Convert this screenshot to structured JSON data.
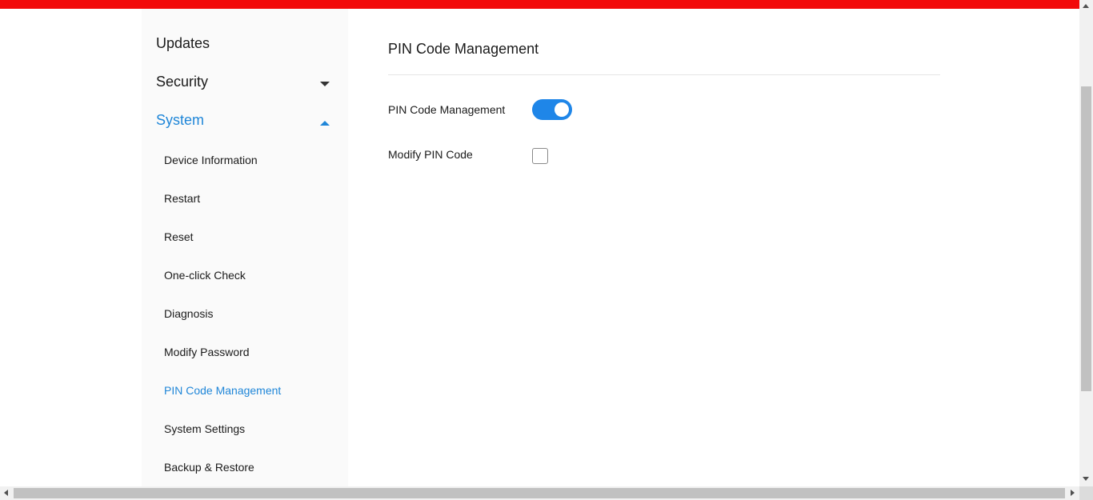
{
  "brand": {
    "accent_color": "#f20a0a",
    "active_color": "#1f86d8"
  },
  "sidebar": {
    "top_items": [
      {
        "label": "Updates",
        "expanded": null
      },
      {
        "label": "Security",
        "expanded": false,
        "icon": "chevron-down-icon"
      },
      {
        "label": "System",
        "expanded": true,
        "icon": "chevron-up-icon",
        "active": true
      }
    ],
    "system_items": [
      {
        "label": "Device Information"
      },
      {
        "label": "Restart"
      },
      {
        "label": "Reset"
      },
      {
        "label": "One-click Check"
      },
      {
        "label": "Diagnosis"
      },
      {
        "label": "Modify Password"
      },
      {
        "label": "PIN Code Management",
        "active": true
      },
      {
        "label": "System Settings"
      },
      {
        "label": "Backup & Restore"
      }
    ]
  },
  "main": {
    "title": "PIN Code Management",
    "pin_code_management": {
      "label": "PIN Code Management",
      "enabled": true
    },
    "modify_pin_code": {
      "label": "Modify PIN Code",
      "checked": false
    }
  }
}
